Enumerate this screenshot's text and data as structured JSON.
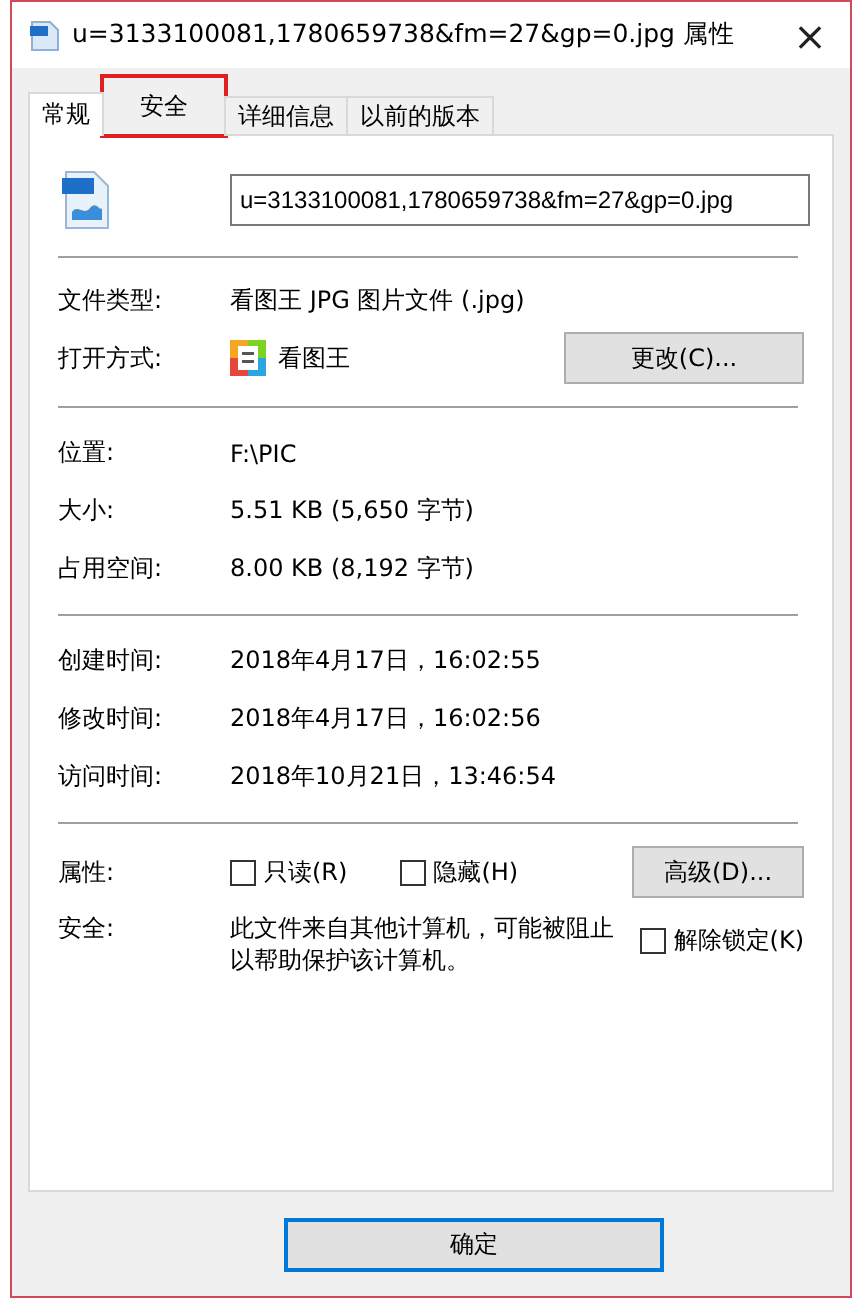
{
  "window": {
    "title": "u=3133100081,1780659738&fm=27&gp=0.jpg 属性",
    "close": "×"
  },
  "tabs": [
    {
      "label": "常规",
      "selected": true,
      "highlighted": false
    },
    {
      "label": "安全",
      "selected": false,
      "highlighted": true
    },
    {
      "label": "详细信息",
      "selected": false,
      "highlighted": false
    },
    {
      "label": "以前的版本",
      "selected": false,
      "highlighted": false
    }
  ],
  "file_name": "u=3133100081,1780659738&fm=27&gp=0.jpg",
  "file_type": {
    "label": "文件类型:",
    "value": "看图王 JPG 图片文件 (.jpg)"
  },
  "opens_with": {
    "label": "打开方式:",
    "value": "看图王",
    "button": "更改(C)..."
  },
  "location_info": [
    {
      "label": "位置:",
      "value": "F:\\PIC"
    },
    {
      "label": "大小:",
      "value": "5.51 KB (5,650 字节)"
    },
    {
      "label": "占用空间:",
      "value": "8.00 KB (8,192 字节)"
    }
  ],
  "times": [
    {
      "label": "创建时间:",
      "value": "2018年4月17日，16:02:55"
    },
    {
      "label": "修改时间:",
      "value": "2018年4月17日，16:02:56"
    },
    {
      "label": "访问时间:",
      "value": "2018年10月21日，13:46:54"
    }
  ],
  "attributes": {
    "label": "属性:",
    "checkboxes": [
      {
        "label": "只读(R)",
        "checked": false
      },
      {
        "label": "隐藏(H)",
        "checked": false
      }
    ],
    "button": "高级(D)..."
  },
  "security": {
    "label": "安全:",
    "text": "此文件来自其他计算机，可能被阻止以帮助保护该计算机。",
    "checkbox": {
      "label": "解除锁定(K)",
      "checked": false
    }
  },
  "buttons": [
    {
      "label": "确定",
      "default": true
    }
  ]
}
